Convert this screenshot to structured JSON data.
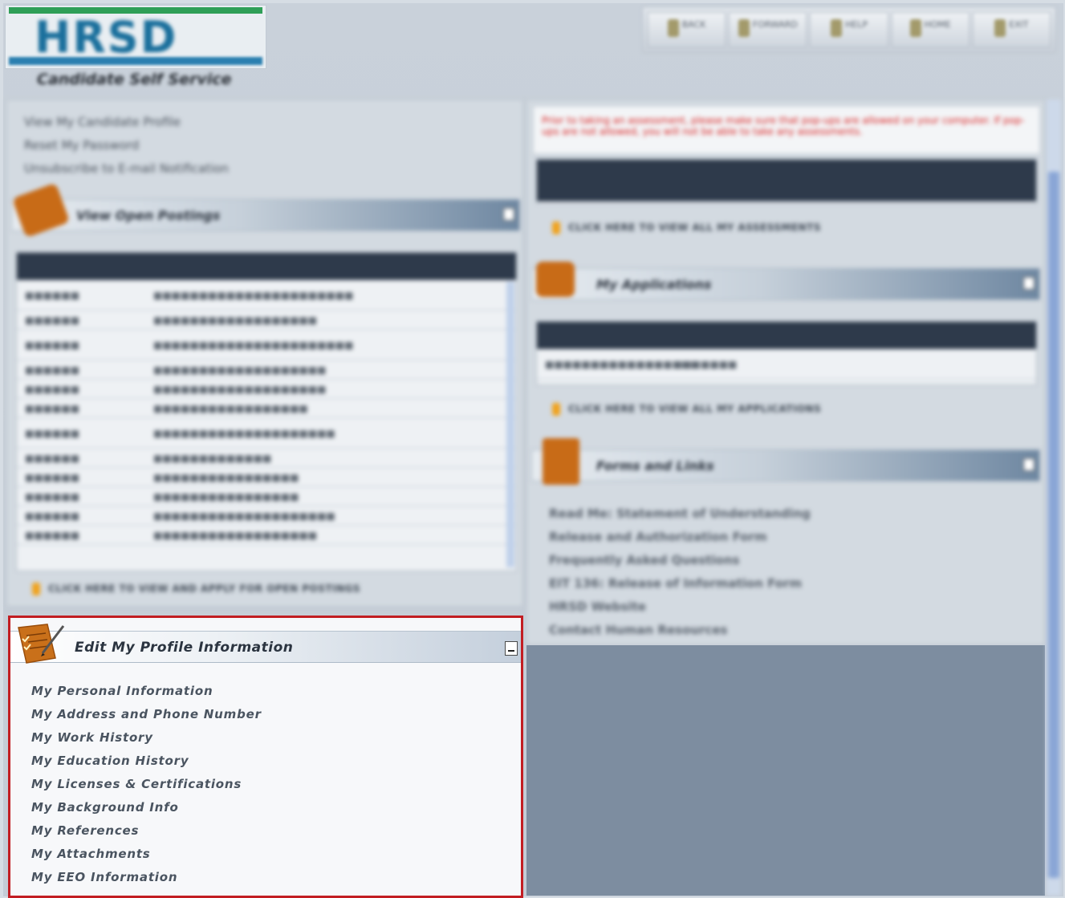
{
  "header": {
    "logo_text": "HRSD",
    "app_title": "Candidate Self Service",
    "nav": [
      "BACK",
      "FORWARD",
      "HELP",
      "HOME",
      "EXIT"
    ]
  },
  "quick_links": [
    "View My Candidate Profile",
    "Reset My Password",
    "Unsubscribe to E-mail Notification"
  ],
  "open_postings": {
    "title": "View Open Postings",
    "click_here": "CLICK HERE TO VIEW AND APPLY FOR OPEN POSTINGS"
  },
  "assessments": {
    "alert": "Prior to taking an assessment, please make sure that pop-ups are allowed on your computer. If pop-ups are not allowed, you will not be able to take any assessments.",
    "click_here": "CLICK HERE TO VIEW ALL MY ASSESSMENTS"
  },
  "applications": {
    "title": "My Applications",
    "click_here": "CLICK HERE TO VIEW ALL MY APPLICATIONS"
  },
  "forms": {
    "title": "Forms and Links",
    "links": [
      "Read Me: Statement of Understanding",
      "Release and Authorization Form",
      "Frequently Asked Questions",
      "EIT 136: Release of Information Form",
      "HRSD Website",
      "Contact Human Resources"
    ]
  },
  "profile": {
    "title": "Edit My Profile Information",
    "links": [
      "My Personal Information",
      "My Address and Phone Number",
      "My Work History",
      "My Education History",
      "My Licenses & Certifications",
      "My Background Info",
      "My References",
      "My Attachments",
      "My EEO Information"
    ]
  },
  "colors": {
    "focus_border": "#c21d22",
    "header_dark": "#2e3a4b",
    "accent_orange": "#c86b17"
  }
}
